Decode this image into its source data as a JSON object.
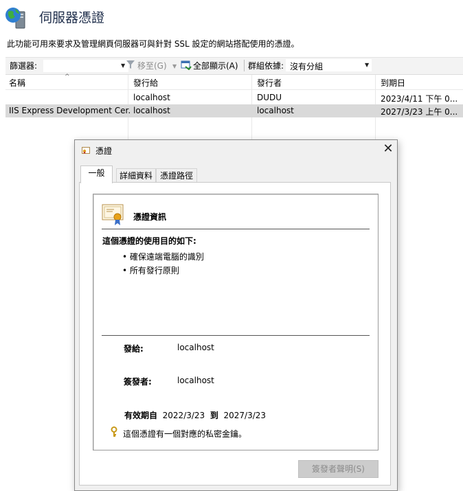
{
  "header": {
    "title": "伺服器憑證",
    "description": "此功能可用來要求及管理網頁伺服器可與針對 SSL 設定的網站搭配使用的憑證。"
  },
  "toolbar": {
    "filter_label": "篩選器:",
    "goto_label": "移至(G)",
    "show_all_label": "全部顯示(A)",
    "group_label": "群組依據:",
    "group_value": "沒有分組"
  },
  "list": {
    "columns": [
      "名稱",
      "發行給",
      "發行者",
      "到期日"
    ],
    "rows": [
      {
        "name": "",
        "issued_to": "localhost",
        "issuer": "DUDU",
        "expires": "2023/4/11 下午 0..."
      },
      {
        "name": "IIS Express Development Cer...",
        "issued_to": "localhost",
        "issuer": "localhost",
        "expires": "2027/3/23 上午 0..."
      }
    ]
  },
  "dialog": {
    "title": "憑證",
    "close_glyph": "✕",
    "tabs": [
      "一般",
      "詳細資料",
      "憑證路徑"
    ],
    "cert_info_title": "憑證資訊",
    "purpose_heading": "這個憑證的使用目的如下:",
    "purposes": [
      "確保遠端電腦的識別",
      "所有發行原則"
    ],
    "issued_to_label": "發給:",
    "issued_to_value": "localhost",
    "issued_by_label": "簽發者:",
    "issued_by_value": "localhost",
    "valid_from_label": "有效期自",
    "valid_from": "2022/3/23",
    "valid_to_label": "到",
    "valid_to": "2027/3/23",
    "private_key_note": "這個憑證有一個對應的私密金鑰。",
    "issuer_statement_button": "簽發者聲明(S)"
  }
}
